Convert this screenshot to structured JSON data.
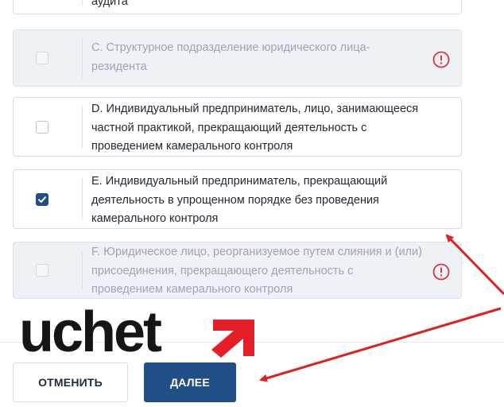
{
  "options": [
    {
      "id": "prev",
      "text_lines": [
        "аудита"
      ]
    },
    {
      "id": "C",
      "text_lines": [
        "C. Структурное подразделение юридического лица-",
        "резидента"
      ],
      "state": "disabled"
    },
    {
      "id": "D",
      "text_lines": [
        "D. Индивидуальный предприниматель, лицо, занимающееся",
        "частной практикой, прекращающий деятельность с",
        "проведением камерального контроля"
      ],
      "state": "unchecked"
    },
    {
      "id": "E",
      "text_lines": [
        "E. Индивидуальный предприниматель, прекращающий",
        "деятельность в упрощенном порядке без проведения",
        "камерального контроля"
      ],
      "state": "checked"
    },
    {
      "id": "F",
      "text_lines": [
        "F. Юридическое лицо, реорганизуемое путем слияния и (или)",
        "присоединения, прекращающего деятельность с",
        "проведением камерального контроля"
      ],
      "state": "disabled"
    }
  ],
  "buttons": {
    "cancel": "ОТМЕНИТЬ",
    "next": "ДАЛЕЕ"
  },
  "watermark": {
    "text": "uchet"
  },
  "colors": {
    "accent": "#1f4f86",
    "warning": "#d9363e",
    "arrow": "#e02020",
    "border": "#d4dbe3"
  },
  "icons": {
    "warning": "exclamation-circle-icon",
    "check": "checkmark-icon",
    "logo_arrow": "diagonal-arrow-icon"
  }
}
